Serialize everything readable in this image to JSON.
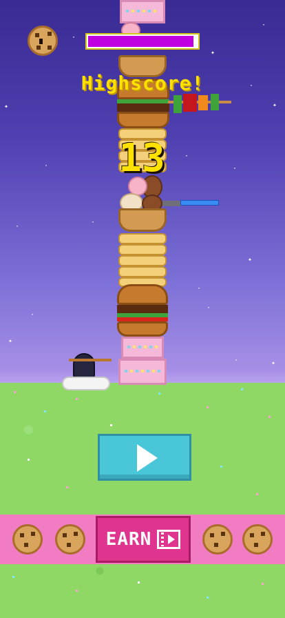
{
  "hud": {
    "cookie_icon": "cookie-face-icon",
    "progress_fraction": 0.97,
    "progress_color": "#c000e0"
  },
  "labels": {
    "highscore": "Highscore!",
    "score": "13"
  },
  "controls": {
    "play_icon": "play-icon",
    "earn_label": "EARN",
    "earn_icon": "video-ad-icon"
  },
  "colors": {
    "sky_top": "#3a2a93",
    "sky_bottom": "#b9a4ef",
    "grass": "#8fd866",
    "bar": "#f27cc4",
    "earn_button": "#e0358f",
    "play_button": "#49c6d8",
    "accent_text": "#ffe100"
  }
}
